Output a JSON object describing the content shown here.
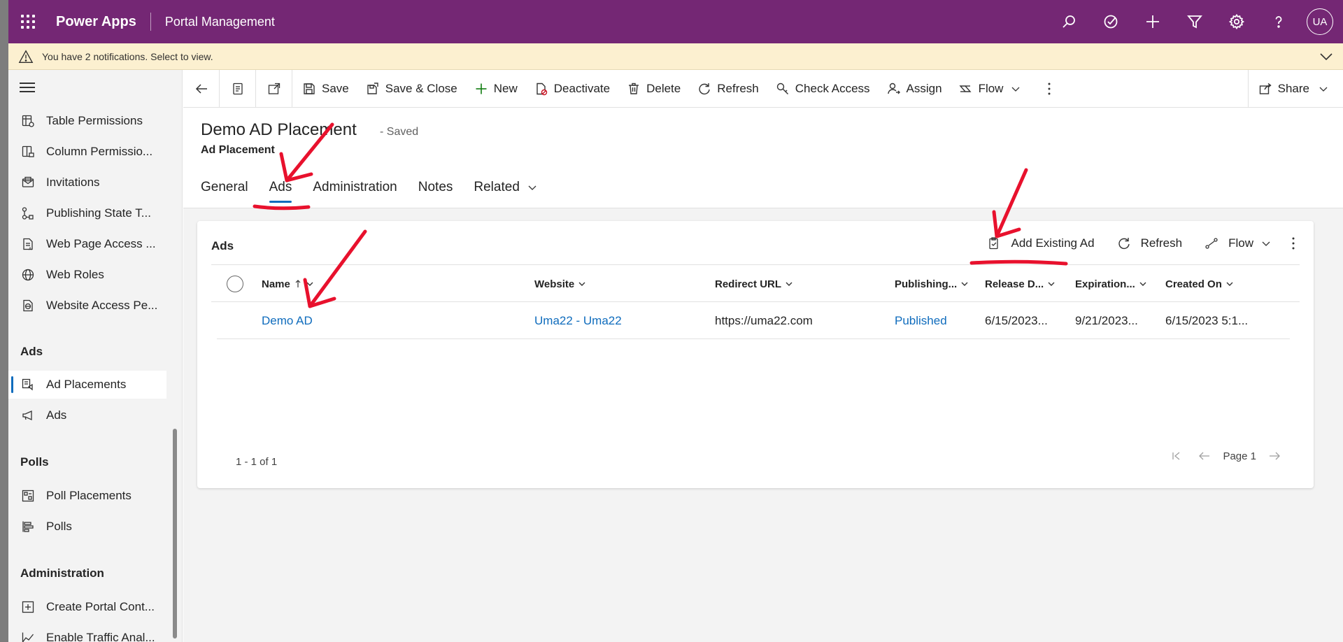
{
  "header": {
    "brand": "Power Apps",
    "app_name": "Portal Management",
    "avatar_initials": "UA",
    "icons": [
      "search-icon",
      "task-icon",
      "plus-icon",
      "filter-icon",
      "gear-icon",
      "help-icon"
    ]
  },
  "notification": {
    "text": "You have 2 notifications. Select to view."
  },
  "sidebar": {
    "items_top": [
      {
        "label": "Table Permissions",
        "icon": "table-permissions-icon"
      },
      {
        "label": "Column Permissio...",
        "icon": "column-permissions-icon"
      },
      {
        "label": "Invitations",
        "icon": "invitations-icon"
      },
      {
        "label": "Publishing State T...",
        "icon": "publishing-state-icon"
      },
      {
        "label": "Web Page Access ...",
        "icon": "web-page-access-icon"
      },
      {
        "label": "Web Roles",
        "icon": "web-roles-icon"
      },
      {
        "label": "Website Access Pe...",
        "icon": "website-access-icon"
      }
    ],
    "groups": [
      {
        "title": "Ads",
        "items": [
          {
            "label": "Ad Placements",
            "icon": "ad-placements-icon",
            "active": true
          },
          {
            "label": "Ads",
            "icon": "megaphone-icon"
          }
        ]
      },
      {
        "title": "Polls",
        "items": [
          {
            "label": "Poll Placements",
            "icon": "poll-placements-icon"
          },
          {
            "label": "Polls",
            "icon": "polls-icon"
          }
        ]
      },
      {
        "title": "Administration",
        "items": [
          {
            "label": "Create Portal Cont...",
            "icon": "create-portal-icon"
          },
          {
            "label": "Enable Traffic Anal...",
            "icon": "traffic-analytics-icon"
          }
        ]
      }
    ]
  },
  "commandbar": {
    "save": "Save",
    "save_close": "Save & Close",
    "new": "New",
    "deactivate": "Deactivate",
    "delete": "Delete",
    "refresh": "Refresh",
    "check_access": "Check Access",
    "assign": "Assign",
    "flow": "Flow",
    "share": "Share"
  },
  "record": {
    "title": "Demo AD Placement",
    "status": "- Saved",
    "entity": "Ad Placement"
  },
  "tabs": {
    "general": "General",
    "ads": "Ads",
    "administration": "Administration",
    "notes": "Notes",
    "related": "Related",
    "active": "Ads"
  },
  "subgrid": {
    "title": "Ads",
    "commands": {
      "add_existing": "Add Existing Ad",
      "refresh": "Refresh",
      "flow": "Flow"
    },
    "columns": [
      "Name",
      "Website",
      "Redirect URL",
      "Publishing...",
      "Release D...",
      "Expiration...",
      "Created On"
    ],
    "rows": [
      [
        "Demo AD",
        "Uma22 - Uma22",
        "https://uma22.com",
        "Published",
        "6/15/2023...",
        "9/21/2023...",
        "6/15/2023 5:1..."
      ]
    ],
    "count": "1 - 1 of 1",
    "page": "Page 1"
  },
  "colors": {
    "header": "#742774",
    "accent": "#0f6cbd",
    "notification_bg": "#fcf0d0",
    "annotation": "#e8112d"
  }
}
